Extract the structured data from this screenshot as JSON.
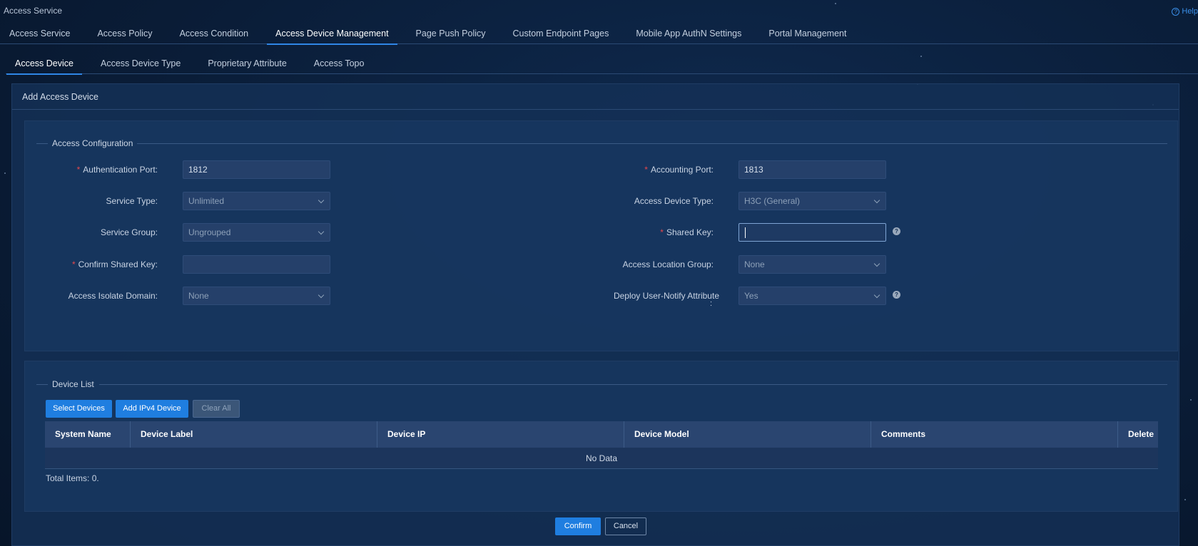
{
  "app": {
    "title": "Access Service",
    "help_label": "Help"
  },
  "main_tabs": [
    {
      "label": "Access Service"
    },
    {
      "label": "Access Policy"
    },
    {
      "label": "Access Condition"
    },
    {
      "label": "Access Device Management"
    },
    {
      "label": "Page Push Policy"
    },
    {
      "label": "Custom Endpoint Pages"
    },
    {
      "label": "Mobile App AuthN Settings"
    },
    {
      "label": "Portal Management"
    }
  ],
  "main_tabs_active": "Access Device Management",
  "sub_tabs": [
    {
      "label": "Access Device"
    },
    {
      "label": "Access Device Type"
    },
    {
      "label": "Proprietary Attribute"
    },
    {
      "label": "Access Topo"
    }
  ],
  "sub_tabs_active": "Access Device",
  "panel": {
    "title": "Add Access Device"
  },
  "access_config": {
    "legend": "Access Configuration",
    "auth_port": {
      "label": "Authentication Port:",
      "value": "1812",
      "required": true
    },
    "acct_port": {
      "label": "Accounting Port:",
      "value": "1813",
      "required": true
    },
    "service_type": {
      "label": "Service Type:",
      "value": "Unlimited"
    },
    "device_type": {
      "label": "Access Device Type:",
      "value": "H3C (General)"
    },
    "service_group": {
      "label": "Service Group:",
      "value": "Ungrouped"
    },
    "shared_key": {
      "label": "Shared Key:",
      "value": "",
      "required": true
    },
    "confirm_key": {
      "label": "Confirm Shared Key:",
      "value": "",
      "required": true
    },
    "location_group": {
      "label": "Access Location Group:",
      "value": "None"
    },
    "isolate_domain": {
      "label": "Access Isolate Domain:",
      "value": "None"
    },
    "deploy_notify": {
      "label": "Deploy User-Notify Attribute",
      "label_colon": ":",
      "value": "Yes"
    },
    "required_mark": "*",
    "info_glyph": "?"
  },
  "device_list": {
    "legend": "Device List",
    "buttons": {
      "select": "Select Devices",
      "add_ipv4": "Add IPv4 Device",
      "clear_all": "Clear All"
    },
    "columns": [
      "System Name",
      "Device Label",
      "Device IP",
      "Device Model",
      "Comments",
      "Delete"
    ],
    "empty_text": "No Data",
    "total_text": "Total Items: 0."
  },
  "footer": {
    "confirm": "Confirm",
    "cancel": "Cancel"
  },
  "colors": {
    "accent": "#1f7ee0",
    "required": "#e5484d",
    "background": "#0a1d38"
  }
}
